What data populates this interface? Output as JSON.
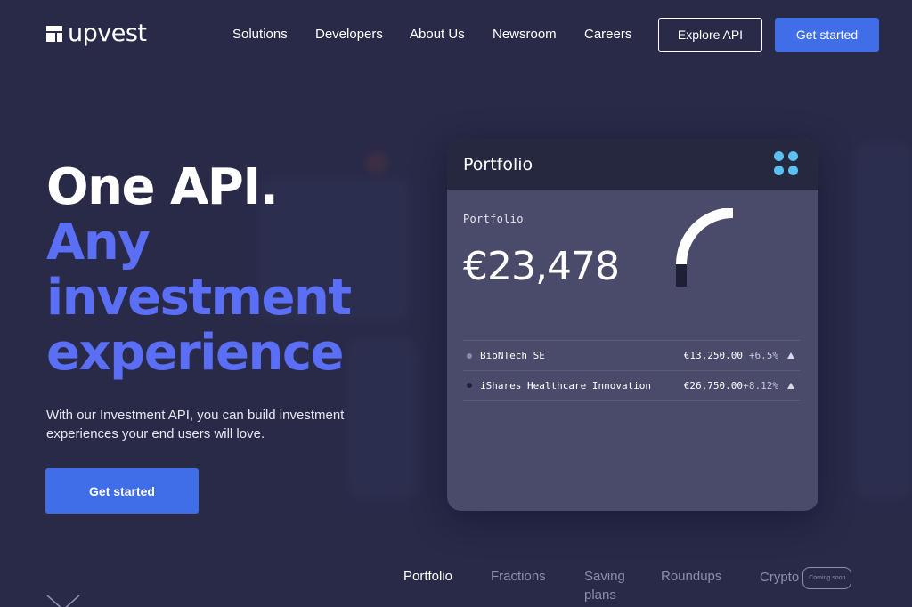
{
  "header": {
    "logo_text": "upvest",
    "nav": [
      "Solutions",
      "Developers",
      "About Us",
      "Newsroom",
      "Careers"
    ],
    "explore_label": "Explore API",
    "get_started_label": "Get started"
  },
  "hero": {
    "title_line1": "One API.",
    "title_accent": [
      "Any",
      "investment",
      "experience"
    ],
    "description": "With our Investment API, you can build investment experiences your end users will love.",
    "cta_label": "Get started"
  },
  "card": {
    "header_title": "Portfolio",
    "label": "Portfolio",
    "value": "€23,478",
    "holdings": [
      {
        "name": "BioNTech SE",
        "amount": "€13,250.00",
        "change": "+6.5%",
        "bullet_color": "#8c8ca4"
      },
      {
        "name": "iShares Healthcare Innovation",
        "amount": "€26,750.00",
        "change": "+8.12%",
        "bullet_color": "#1e2036"
      }
    ]
  },
  "tabs": {
    "items": [
      "Portfolio",
      "Fractions",
      "Saving plans",
      "Roundups",
      "Crypto"
    ],
    "active": "Portfolio",
    "crypto_badge": "Coming soon"
  },
  "colors": {
    "background": "#282a48",
    "accent": "#5b6ef6",
    "button": "#3f6ee8",
    "dots": "#5bc0f0"
  }
}
